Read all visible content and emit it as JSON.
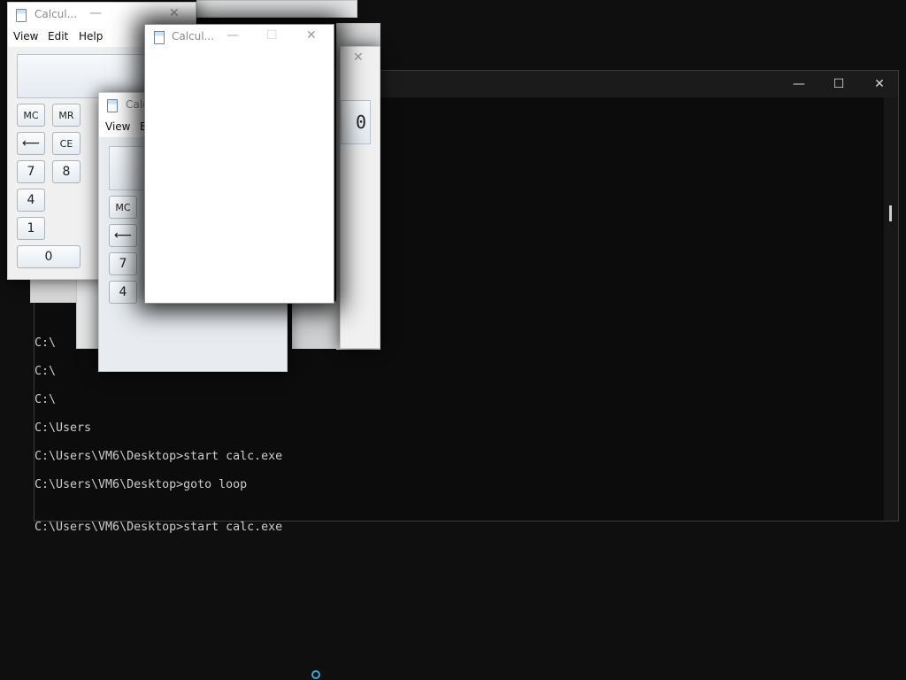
{
  "console": {
    "controls": {
      "minimize": "—",
      "maximize": "☐",
      "close": "✕"
    },
    "lines": [
      "C:\\",
      "C:\\",
      "C:\\",
      "C:\\Users",
      "C:\\Users\\VM6\\Desktop>start calc.exe",
      "C:\\Users\\VM6\\Desktop>goto loop",
      "C:\\Users\\VM6\\Desktop>start calc.exe"
    ]
  },
  "calc_back": {
    "title": "Calcul...",
    "menu": {
      "view": "View",
      "edit": "Edit",
      "help": "Help"
    },
    "keys": {
      "mc": "MC",
      "mr": "MR",
      "back": "⟵",
      "ce": "CE",
      "seven": "7",
      "eight": "8",
      "four": "4",
      "one": "1",
      "zero": "0"
    },
    "controls": {
      "minimize": "—",
      "close": "✕"
    }
  },
  "calc_mid": {
    "title": "Calc",
    "menu": {
      "view": "View",
      "edit": "E"
    },
    "keys": {
      "mc": "MC",
      "back": "⟵",
      "seven": "7",
      "four": "4"
    }
  },
  "calc_right": {
    "display_value": "0",
    "controls": {
      "close": "✕"
    }
  },
  "calc_front": {
    "title": "Calcul...",
    "controls": {
      "minimize": "—",
      "maximize": "☐",
      "close": "✕"
    }
  }
}
